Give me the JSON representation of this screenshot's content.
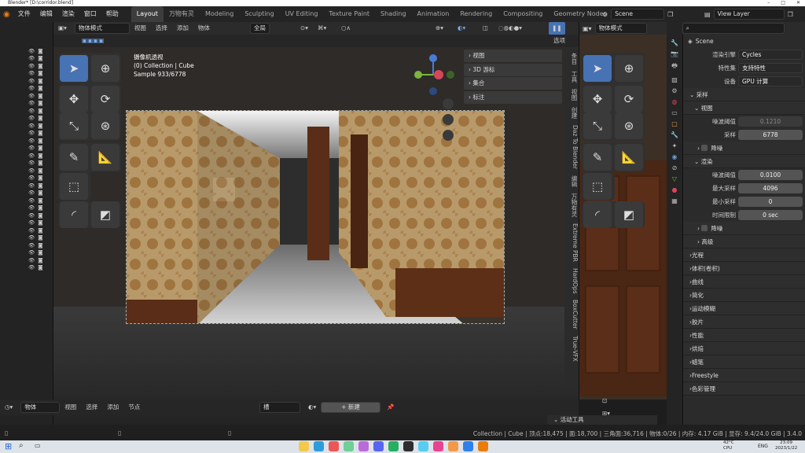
{
  "window": {
    "title": "Blender* [D:\\corridor.blend]"
  },
  "menu": {
    "items": [
      "文件",
      "编辑",
      "渲染",
      "窗口",
      "帮助"
    ]
  },
  "workspaces": {
    "tabs": [
      "Layout",
      "万物有灵",
      "Modeling",
      "Sculpting",
      "UV Editing",
      "Texture Paint",
      "Shading",
      "Animation",
      "Rendering",
      "Compositing",
      "Geometry Nodes",
      "Scripting"
    ],
    "active": "Layout"
  },
  "scene": {
    "name": "Scene",
    "view_layer": "View Layer"
  },
  "viewport": {
    "mode": "物体模式",
    "menus": [
      "视图",
      "选择",
      "添加",
      "物体"
    ],
    "transform_orientation": "全局",
    "options_label": "选项",
    "overlay_title": "摄像机透视",
    "overlay_collection": "(0) Collection | Cube",
    "overlay_sample": "Sample 933/6778"
  },
  "npanel": {
    "sections": [
      "视图",
      "3D 游标",
      "集合",
      "标注"
    ]
  },
  "sidebar_tabs": [
    "条目",
    "工具",
    "视图",
    "创建",
    "Daz To Blender",
    "编辑",
    "万物有灵",
    "Extreme PBR",
    "HardOps",
    "BoxCutter",
    "True-VFX"
  ],
  "second_view": {
    "mode": "物体模式"
  },
  "properties": {
    "scene_label": "Scene",
    "render_engine_label": "渲染引擎",
    "render_engine": "Cycles",
    "feature_set_label": "特性集",
    "feature_set": "支持特性",
    "device_label": "设备",
    "device": "GPU 计算",
    "sampling": "采样",
    "viewport_sub": "视图",
    "vp_noise_label": "噪波阈值",
    "vp_noise": "0.1210",
    "vp_samples_label": "采样",
    "vp_samples": "6778",
    "denoise": "降噪",
    "render_sub": "渲染",
    "r_noise_label": "噪波阈值",
    "r_noise": "0.0100",
    "r_max_label": "最大采样",
    "r_max": "4096",
    "r_min_label": "最小采样",
    "r_min": "0",
    "r_time_label": "时间限制",
    "r_time": "0 sec",
    "denoise2": "降噪",
    "advanced": "高级",
    "sections": [
      "光程",
      "体积(卷积)",
      "曲线",
      "简化",
      "运动模糊",
      "胶片",
      "性能",
      "烘焙",
      "蜡笔",
      "Freestyle",
      "色彩管理"
    ]
  },
  "timeline": {
    "object_label": "物体",
    "menus": [
      "视图",
      "选择",
      "添加",
      "节点"
    ],
    "slot": "槽",
    "new_label": "新建",
    "active_tool": "活动工具"
  },
  "status": {
    "text": "Collection | Cube | 顶点:18,475 | 面:18,700 | 三角面:36,716 | 物体:0/26 | 内存: 4.17 GiB | 显存: 9.4/24.0 GiB | 3.4.0"
  },
  "taskbar": {
    "temp": "42°C",
    "temp_label": "CPU",
    "lang": "ENG",
    "time": "23:09",
    "date": "2023/1/22"
  }
}
